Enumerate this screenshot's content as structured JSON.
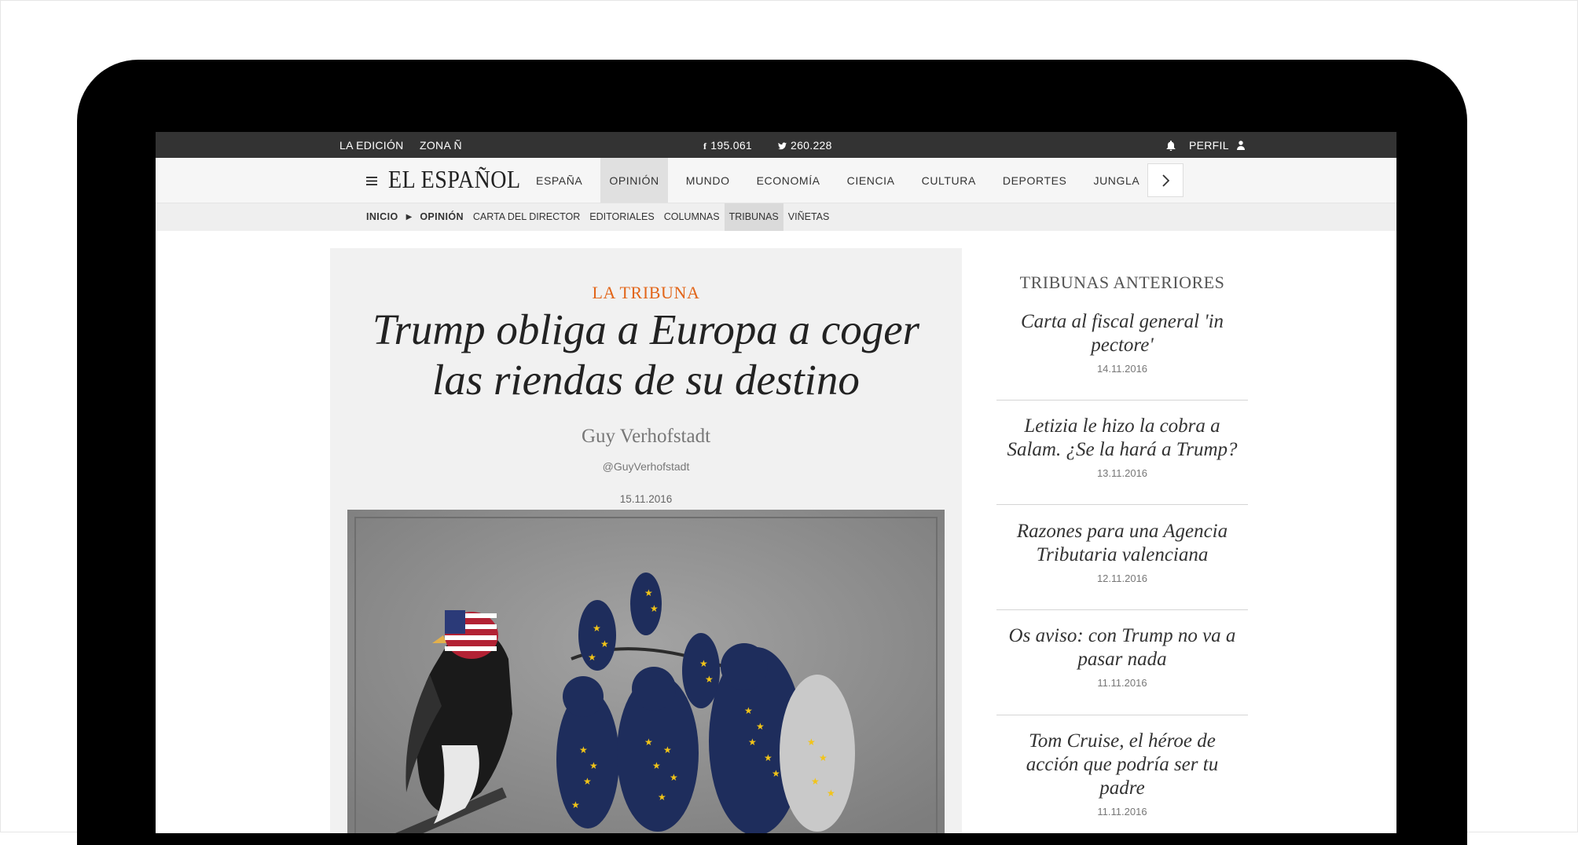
{
  "topbar": {
    "edition": "LA EDICIÓN",
    "zone": "ZONA Ñ",
    "facebook_count": "195.061",
    "twitter_count": "260.228",
    "profile": "PERFIL"
  },
  "brand": {
    "logo": "EL ESPAÑOL"
  },
  "nav": {
    "items": [
      {
        "label": "ESPAÑA"
      },
      {
        "label": "OPINIÓN"
      },
      {
        "label": "MUNDO"
      },
      {
        "label": "ECONOMÍA"
      },
      {
        "label": "CIENCIA"
      },
      {
        "label": "CULTURA"
      },
      {
        "label": "DEPORTES"
      },
      {
        "label": "JUNGLA"
      }
    ],
    "active_index": 1
  },
  "breadcrumb": {
    "home": "INICIO",
    "section": "OPINIÓN",
    "links": [
      {
        "label": "CARTA DEL DIRECTOR"
      },
      {
        "label": "EDITORIALES"
      },
      {
        "label": "COLUMNAS"
      },
      {
        "label": "TRIBUNAS"
      },
      {
        "label": "VIÑETAS"
      }
    ],
    "active_index": 3
  },
  "article": {
    "kicker": "LA TRIBUNA",
    "headline_line1": "Trump obliga a Europa a coger",
    "headline_line2": "las riendas de su destino",
    "author": "Guy Verhofstadt",
    "handle": "@GuyVerhofstadt",
    "date": "15.11.2016"
  },
  "sidebar": {
    "title": "TRIBUNAS ANTERIORES",
    "items": [
      {
        "title_line1": "Carta al fiscal general 'in",
        "title_line2": "pectore'",
        "title_line3": "",
        "date": "14.11.2016"
      },
      {
        "title_line1": "Letizia le hizo la cobra a",
        "title_line2": "Salam. ¿Se la hará a Trump?",
        "title_line3": "",
        "date": "13.11.2016"
      },
      {
        "title_line1": "Razones para una Agencia",
        "title_line2": "Tributaria valenciana",
        "title_line3": "",
        "date": "12.11.2016"
      },
      {
        "title_line1": "Os aviso: con Trump no va a",
        "title_line2": "pasar nada",
        "title_line3": "",
        "date": "11.11.2016"
      },
      {
        "title_line1": "Tom Cruise, el héroe de",
        "title_line2": "acción que podría ser tu",
        "title_line3": "padre",
        "date": "11.11.2016"
      }
    ]
  },
  "colors": {
    "kicker": "#e2661a",
    "topbar_bg": "#333333",
    "owl_blue": "#1e2d5c",
    "star_yellow": "#f2c418"
  },
  "icons": [
    "facebook-icon",
    "twitter-icon",
    "bell-icon",
    "user-icon",
    "hamburger-menu-icon",
    "chevron-right-icon",
    "triangle-right-icon"
  ]
}
